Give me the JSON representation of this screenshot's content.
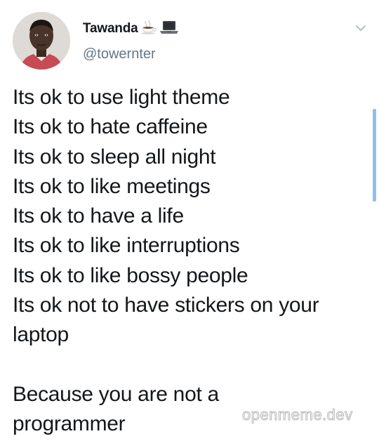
{
  "tweet": {
    "display_name": "Tawanda",
    "name_emojis": [
      "coffee-icon",
      "laptop-icon"
    ],
    "handle": "@towernter",
    "lines": [
      "Its ok to use light theme",
      "Its ok to hate caffeine",
      "Its ok to sleep all night",
      "Its ok to like meetings",
      "Its ok to have a life",
      "Its ok to like interruptions",
      "Its ok to like bossy people",
      "Its ok not to have stickers on your",
      "laptop",
      "",
      "Because you are not a",
      "programmer"
    ]
  },
  "watermark": "openmeme.dev",
  "colors": {
    "text": "#14171a",
    "secondary": "#657786",
    "scroll_accent": "#90c1ea"
  }
}
